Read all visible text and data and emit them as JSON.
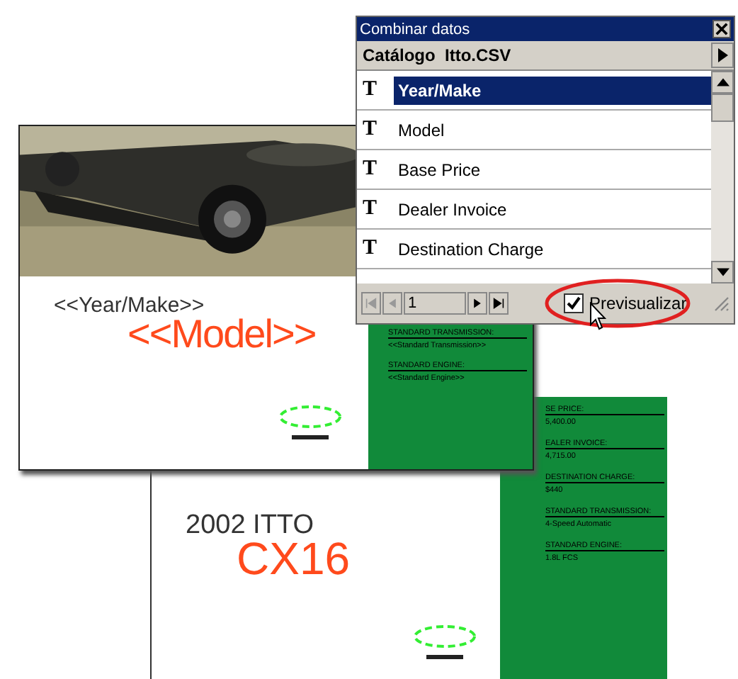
{
  "panel": {
    "title": "Combinar datos",
    "source": "Catálogo  Itto.CSV",
    "fields": [
      {
        "icon": "T",
        "label": "Year/Make",
        "selected": true
      },
      {
        "icon": "T",
        "label": "Model",
        "selected": false
      },
      {
        "icon": "T",
        "label": "Base Price",
        "selected": false
      },
      {
        "icon": "T",
        "label": "Dealer Invoice",
        "selected": false
      },
      {
        "icon": "T",
        "label": "Destination Charge",
        "selected": false
      }
    ],
    "record": "1",
    "preview": {
      "label": "Previsualizar",
      "checked": true
    }
  },
  "template": {
    "year_make": "<<Year/Make>>",
    "model": "<<Model>>",
    "specs": [
      {
        "label": "STANDARD TRANSMISSION:",
        "value": "<<Standard Transmission>>"
      },
      {
        "label": "STANDARD ENGINE:",
        "value": "<<Standard Engine>>"
      }
    ]
  },
  "preview_page": {
    "year_make": "2002 ITTO",
    "model": "CX16",
    "specs": [
      {
        "label": "SE PRICE:",
        "value": "5,400.00"
      },
      {
        "label": "EALER INVOICE:",
        "value": "4,715.00"
      },
      {
        "label": "DESTINATION CHARGE:",
        "value": "$440"
      },
      {
        "label": "STANDARD TRANSMISSION:",
        "value": "4-Speed Automatic"
      },
      {
        "label": "STANDARD ENGINE:",
        "value": "1.8L FCS"
      }
    ]
  }
}
